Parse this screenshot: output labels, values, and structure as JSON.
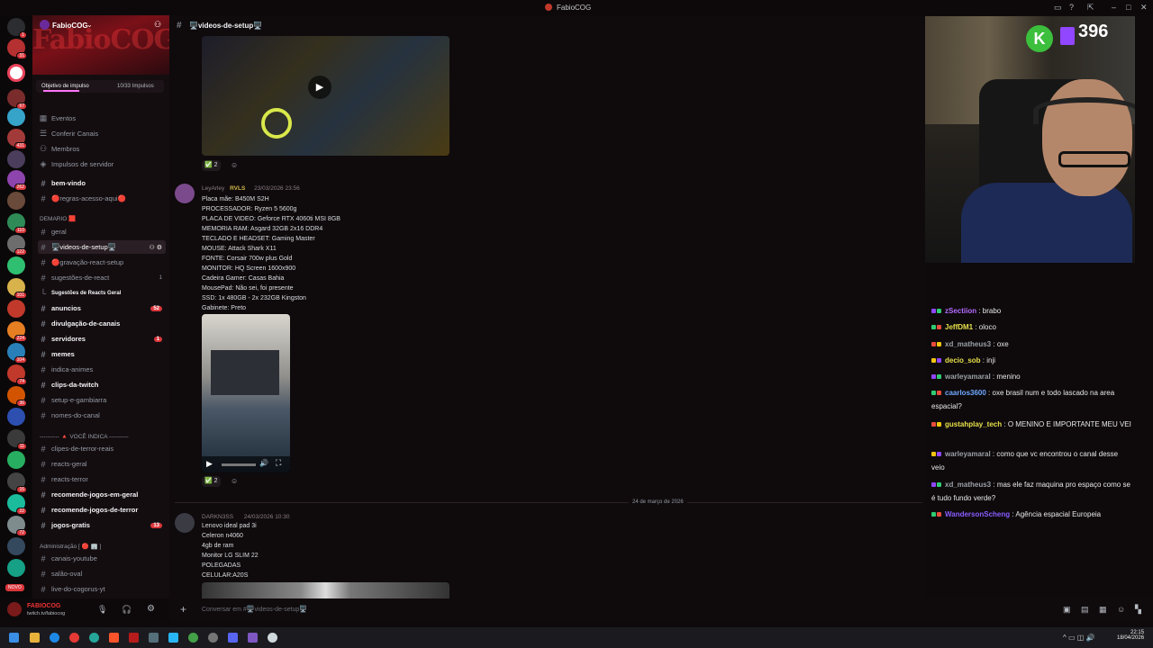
{
  "window": {
    "title": "FabioCOG"
  },
  "server": {
    "name": "FabioCOG",
    "banner_text": "FabioCOG",
    "boost_goal": "Objetivo de impulso",
    "boost_count": "10/33 Impulsos"
  },
  "rail_badges": [
    "1",
    "31",
    "67",
    "431",
    "262",
    "110",
    "122",
    "101",
    "224",
    "104",
    "74",
    "36",
    "11",
    "16",
    "22",
    "72"
  ],
  "rail_new": "NOVO",
  "nav": [
    {
      "label": "Eventos",
      "icon": "calendar-icon"
    },
    {
      "label": "Conferir Canais",
      "icon": "browse-icon"
    },
    {
      "label": "Membros",
      "icon": "members-icon"
    },
    {
      "label": "Impulsos de servidor",
      "icon": "boost-icon"
    }
  ],
  "channels_top": [
    {
      "label": "bem-vindo",
      "bold": true
    },
    {
      "label": "🔴regras-acesso-aqui🔴",
      "bold": false
    }
  ],
  "category1": "DEMARIO 🟥",
  "channels1": [
    {
      "label": "geral",
      "bold": false
    },
    {
      "label": "🖥️videos-de-setup🖥️",
      "bold": false,
      "selected": true
    },
    {
      "label": "🔴gravação-react-setup",
      "bold": false
    },
    {
      "label": "sugestões-de-react",
      "bold": false,
      "count": "1"
    },
    {
      "label": "Sugestões de Reacts Geral",
      "bold": true,
      "thread": true
    },
    {
      "label": "anuncios",
      "bold": true,
      "badge": "52"
    },
    {
      "label": "divulgação-de-canais",
      "bold": true
    },
    {
      "label": "servidores",
      "bold": true,
      "badge": "1"
    },
    {
      "label": "memes",
      "bold": true
    },
    {
      "label": "indica-animes",
      "bold": false
    },
    {
      "label": "clips-da-twitch",
      "bold": true
    },
    {
      "label": "setup-e-gambiarra",
      "bold": false
    },
    {
      "label": "nomes-do-canal",
      "bold": false
    }
  ],
  "category2": "---------- 🔺 VOCÊ INDICA ----------",
  "channels2": [
    {
      "label": "clipes-de-terror-reais",
      "bold": false
    },
    {
      "label": "reacts-geral",
      "bold": false
    },
    {
      "label": "reacts-terror",
      "bold": false
    },
    {
      "label": "recomende-jogos-em-geral",
      "bold": true
    },
    {
      "label": "recomende-jogos-de-terror",
      "bold": true
    },
    {
      "label": "jogos-gratis",
      "bold": true,
      "badge": "13"
    }
  ],
  "category3": "Administração [ 🔴 🏢 ]",
  "channels3": [
    {
      "label": "canais-youtube",
      "bold": false
    },
    {
      "label": "salão-oval",
      "bold": false
    },
    {
      "label": "live-do-cogorus-yt",
      "bold": false
    }
  ],
  "user": {
    "name": "FABIOCOG",
    "status": "twitch.tv/fabiocog"
  },
  "channel_header": "🖥️videos-de-setup🖥️",
  "reactions1": [
    "✅",
    "2"
  ],
  "post1": {
    "author": "LeyArley",
    "tag": "RVLS",
    "time": "23/03/2026 23:56",
    "lines": [
      "Placa mãe: B450M S2H",
      "PROCESSADOR: Ryzen 5 5600g",
      "PLACA DE VIDEO: Geforce RTX 4060ti MSI 8GB",
      "MEMORIA RAM: Asgard 32GB 2x16 DDR4",
      "TECLADO E HEADSET: Gaming Master",
      "MOUSE: Attack Shark X11",
      "FONTE: Corsair 700w plus Gold",
      "MONITOR: HQ Screen 1600x900",
      "Cadeira Gamer: Casas Bahia",
      "MousePad: Não sei, foi presente",
      "SSD: 1x 480GB - 2x 232GB Kingston",
      "Gabinete: Preto"
    ]
  },
  "reactions2": [
    "✅",
    "2"
  ],
  "date_divider": "24 de março de 2026",
  "post2": {
    "author": "DARKN3SS",
    "time": "24/03/2026 10:30",
    "lines": [
      "Lenovo ideal pad 3i",
      "Celeron n4060",
      "4gb de ram",
      "Monitor LG SLIM 22",
      "POLEGADAS",
      "CELULAR:A20S"
    ]
  },
  "composer_placeholder": "Conversar em #🖥️videos-de-setup🖥️",
  "stream": {
    "viewer_count": "396"
  },
  "chat": [
    {
      "user": "zSectiion",
      "color": "#b46bff",
      "text": "brabo"
    },
    {
      "user": "JeffDM1",
      "color": "#e6e04a",
      "text": "oloco"
    },
    {
      "user": "xd_matheus3",
      "color": "#9aa0a6",
      "text": "oxe"
    },
    {
      "user": "decio_sob",
      "color": "#e6e04a",
      "text": "inji"
    },
    {
      "user": "warleyamaral",
      "color": "#9aa0a6",
      "text": "menino"
    },
    {
      "user": "caarlos3600",
      "color": "#6fa8ff",
      "text": "oxe brasil num e todo lascado na area espacial?"
    },
    {
      "user": "gustahplay_tech",
      "color": "#e6e04a",
      "text": "O MENINO E IMPORTANTE MEU VEI"
    },
    {
      "user": "warleyamaral",
      "color": "#9aa0a6",
      "text": "como que vc encontrou o canal desse veio"
    },
    {
      "user": "xd_matheus3",
      "color": "#9aa0a6",
      "text": "mas ele faz maquina pro espaço como se é tudo fundo verde?"
    },
    {
      "user": "WandersonScheng",
      "color": "#8a5cff",
      "text": "Agência espacial Europeia"
    }
  ],
  "clock": {
    "time": "22:15",
    "date": "18/04/2026"
  }
}
